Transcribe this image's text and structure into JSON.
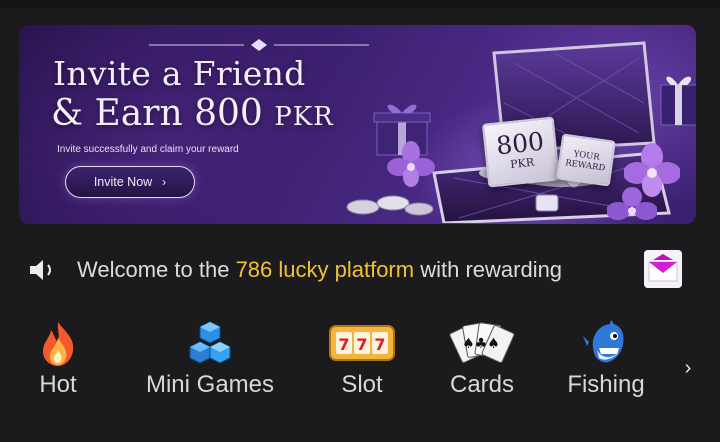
{
  "banner": {
    "title_line1": "Invite a Friend",
    "title_line2_prefix": "& Earn ",
    "title_amount": "800",
    "title_currency": "PKR",
    "subtitle": "Invite successfully and claim your reward",
    "button_label": "Invite Now",
    "card_amount": "800",
    "card_currency": "PKR",
    "reward_card_line1": "YOUR",
    "reward_card_line2": "REWARD"
  },
  "announcement": {
    "text_before": "Welcome to the ",
    "highlight": "786 lucky platform",
    "text_after": " with rewarding",
    "highlight_color": "#f2c233"
  },
  "categories": [
    {
      "label": "Hot",
      "icon": "flame-icon"
    },
    {
      "label": "Mini Games",
      "icon": "cubes-icon"
    },
    {
      "label": "Slot",
      "icon": "slot-machine-icon"
    },
    {
      "label": "Cards",
      "icon": "playing-cards-icon"
    },
    {
      "label": "Fishing",
      "icon": "shark-icon"
    }
  ],
  "colors": {
    "background": "#1b1b1d",
    "accent_purple": "#4a2a86",
    "highlight_yellow": "#f2c233"
  }
}
